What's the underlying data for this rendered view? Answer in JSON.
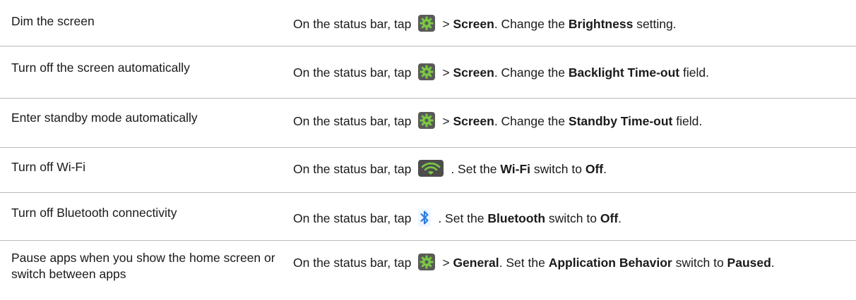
{
  "rows": [
    {
      "task": "Dim the screen",
      "icon": "gear-icon",
      "prefix": "On the status bar, tap",
      "sep": ">",
      "menu": "Screen",
      "mid": ". Change the",
      "setting": "Brightness",
      "tail": "setting."
    },
    {
      "task": "Turn off the screen automatically",
      "icon": "gear-icon",
      "prefix": "On the status bar, tap",
      "sep": ">",
      "menu": "Screen",
      "mid": ". Change the",
      "setting": "Backlight Time-out",
      "tail": "field."
    },
    {
      "task": "Enter standby mode automatically",
      "icon": "gear-icon",
      "prefix": "On the status bar, tap",
      "sep": ">",
      "menu": "Screen",
      "mid": ". Change the",
      "setting": "Standby Time-out",
      "tail": "field."
    },
    {
      "task": "Turn off Wi-Fi",
      "icon": "wifi-icon",
      "prefix": "On the status bar, tap",
      "mid": ". Set the",
      "setting": "Wi-Fi",
      "tail": "switch to",
      "value": "Off",
      "end": "."
    },
    {
      "task": "Turn off Bluetooth connectivity",
      "icon": "bluetooth-icon",
      "prefix": "On the status bar, tap",
      "mid": ". Set the",
      "setting": "Bluetooth",
      "tail": "switch to",
      "value": "Off",
      "end": "."
    },
    {
      "task": "Pause apps when you show the home screen or switch between apps",
      "icon": "gear-icon",
      "prefix": "On the status bar, tap",
      "sep": ">",
      "menu": "General",
      "mid": ". Set the",
      "setting": "Application Behavior",
      "tail": "switch to",
      "value": "Paused",
      "end": "."
    }
  ],
  "colors": {
    "gear_bg": "#5a5a5a",
    "wifi_green": "#7ac943",
    "bluetooth_blue": "#2a7de1",
    "divider": "#b9b9b9"
  }
}
